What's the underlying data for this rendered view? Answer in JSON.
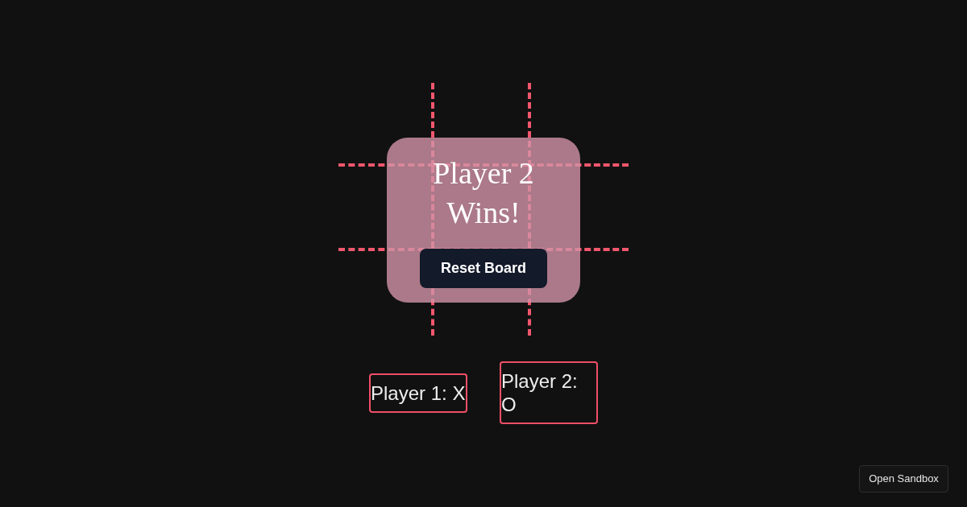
{
  "result_overlay": {
    "message": "Player 2 Wins!",
    "button": "Reset Board"
  },
  "players": [
    {
      "label": "Player 1: X"
    },
    {
      "label": "Player 2: O"
    }
  ],
  "sandbox_button": "Open Sandbox"
}
